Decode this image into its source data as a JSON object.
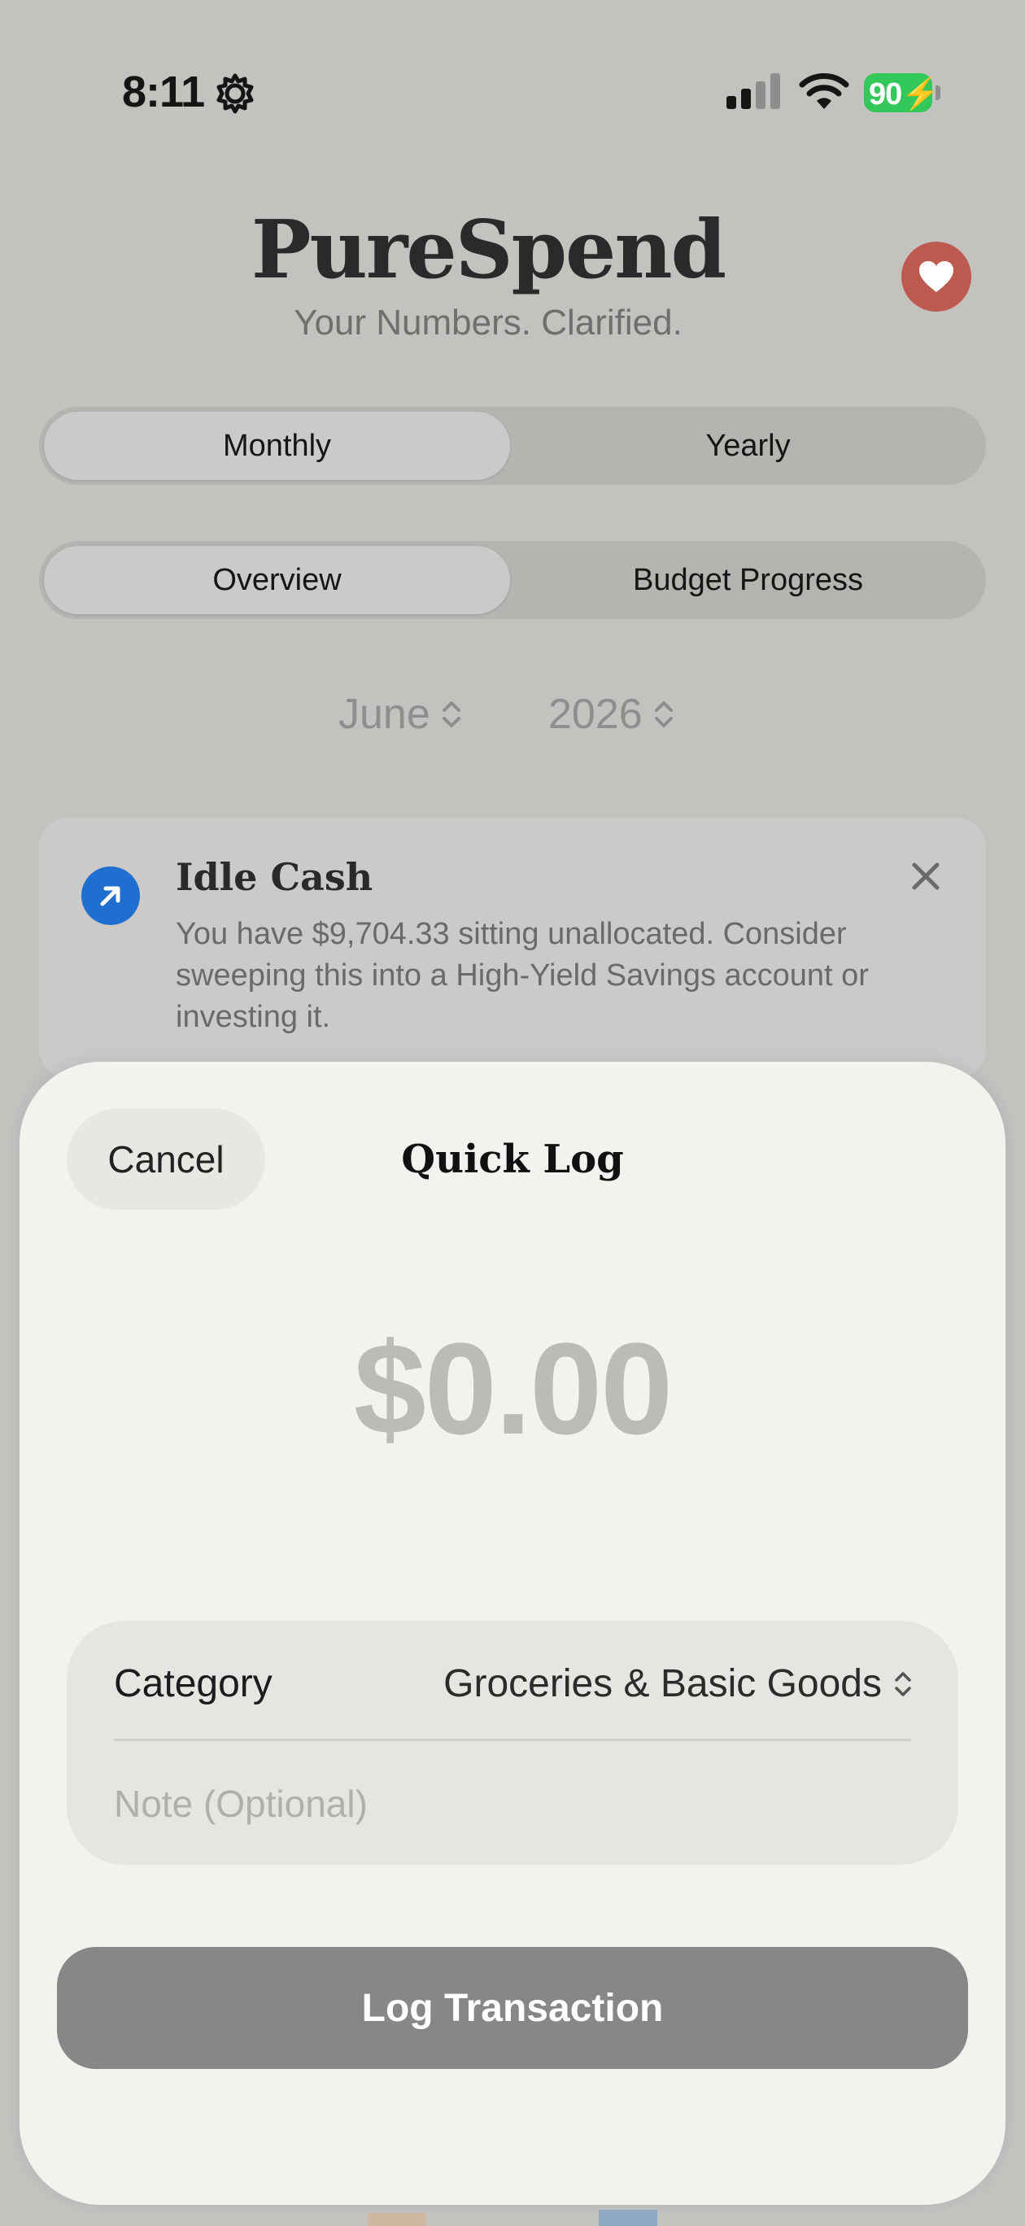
{
  "status_bar": {
    "time": "8:11",
    "battery": "90",
    "icons": [
      "gear-icon",
      "cellular-signal-icon",
      "wifi-icon",
      "battery-charging-icon"
    ]
  },
  "header": {
    "title": "PureSpend",
    "subtitle": "Your Numbers. Clarified.",
    "favorite_icon": "heart-icon"
  },
  "period_toggle": {
    "options": [
      "Monthly",
      "Yearly"
    ],
    "selected": "Monthly"
  },
  "view_toggle": {
    "options": [
      "Overview",
      "Budget Progress"
    ],
    "selected": "Overview"
  },
  "date_picker": {
    "month": "June",
    "year": "2026"
  },
  "insight_card": {
    "icon": "arrow-up-right-icon",
    "title": "Idle Cash",
    "body": "You have $9,704.33 sitting unallocated. Consider sweeping this into a High-Yield Savings account or investing it."
  },
  "quick_log": {
    "cancel_label": "Cancel",
    "title": "Quick Log",
    "amount": "$0.00",
    "category_label": "Category",
    "category_value": "Groceries & Basic Goods",
    "note_placeholder": "Note (Optional)",
    "submit_label": "Log Transaction"
  },
  "colors": {
    "accent_blue": "#1e6fd0",
    "favorite_red": "#bd5a4f",
    "battery_green": "#34c759",
    "button_disabled": "#87878a"
  }
}
